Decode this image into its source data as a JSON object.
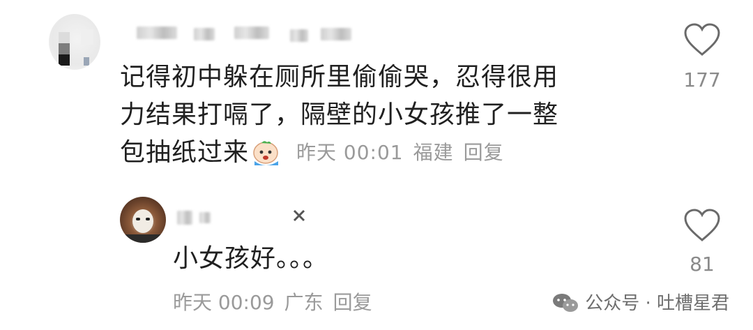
{
  "main_comment": {
    "text_lines": [
      "记得初中躲在厕所里偷偷哭，忍得很用",
      "力结果打嗝了，隔壁的小女孩推了一整",
      "包抽纸过来"
    ],
    "emoji": "crying-emoji",
    "time": "昨天 00:01",
    "location": "福建",
    "reply_label": "回复",
    "likes": "177"
  },
  "reply_comment": {
    "text": "小女孩好。。。",
    "time": "昨天 00:09",
    "location": "广东",
    "reply_label": "回复",
    "likes": "81"
  },
  "watermark": {
    "text": "公众号 · 吐槽星君",
    "icon": "wechat-icon"
  },
  "colors": {
    "text": "#202020",
    "meta": "#9a9a9a",
    "background": "#ffffff"
  }
}
